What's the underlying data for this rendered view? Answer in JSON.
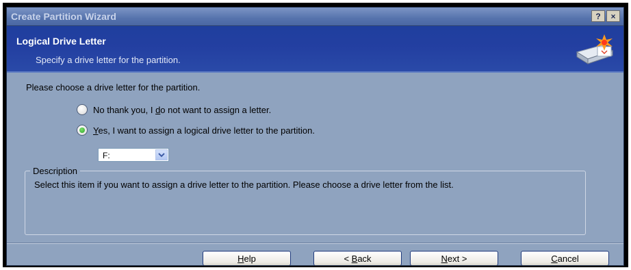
{
  "window": {
    "title": "Create Partition Wizard",
    "help_label": "?",
    "close_label": "×"
  },
  "header": {
    "title": "Logical Drive Letter",
    "subtitle": "Specify a drive letter for the partition."
  },
  "body": {
    "prompt": "Please choose a drive letter for the partition.",
    "option_no": {
      "prefix": "No thank you, I ",
      "accel": "d",
      "suffix": "o not want to assign a letter.",
      "selected": false
    },
    "option_yes": {
      "prefix": "",
      "accel": "Y",
      "suffix": "es, I want to assign a logical drive letter to the partition.",
      "selected": true
    },
    "drive_select": {
      "value": "F:"
    }
  },
  "description": {
    "legend": "Description",
    "text": "Select this item if you want to assign a drive letter to the partition. Please choose a drive letter from the list."
  },
  "buttons": {
    "help": {
      "accel": "H",
      "rest": "elp"
    },
    "back": {
      "prefix": "< ",
      "accel": "B",
      "rest": "ack"
    },
    "next": {
      "accel": "N",
      "rest": "ext >"
    },
    "cancel": {
      "accel": "C",
      "rest": "ancel"
    }
  },
  "colors": {
    "header_blue": "#233fa1",
    "dialog_body": "#8fa3bf",
    "radio_selected": "#2fa52a"
  },
  "icons": {
    "header_icon": "disk-drive-new-partition-icon",
    "combo_arrow": "chevron-down-icon"
  }
}
